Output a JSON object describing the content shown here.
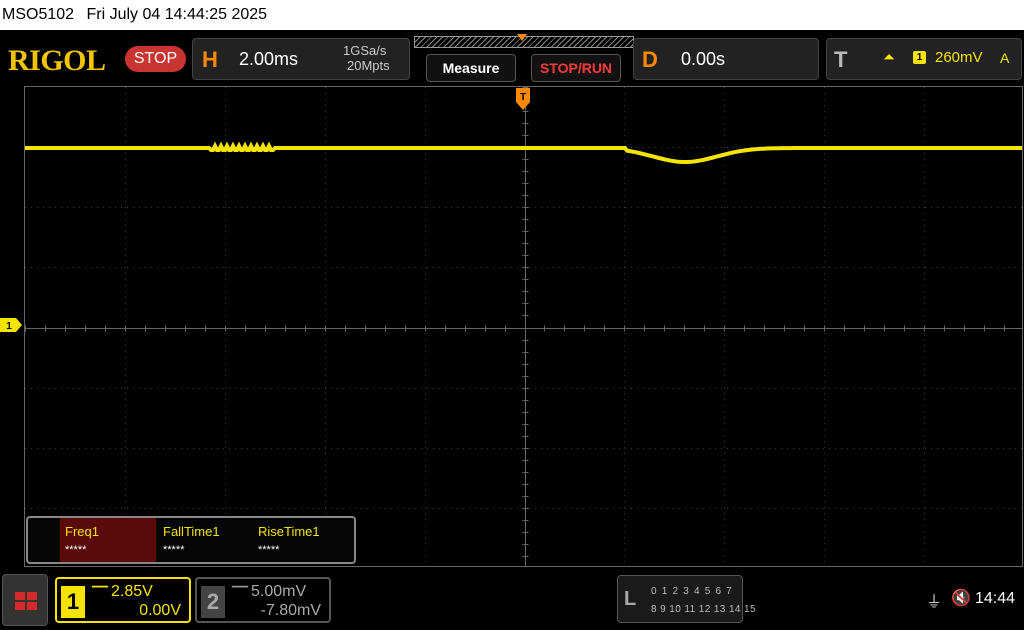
{
  "status_bar": {
    "model": "MSO5102",
    "datetime": "Fri July 04 14:44:25 2025"
  },
  "header": {
    "brand": "RIGOL",
    "run_state": "STOP",
    "horizontal": {
      "letter": "H",
      "timebase": "2.00ms",
      "sample_rate": "1GSa/s",
      "memory_depth": "20Mpts"
    },
    "measure_label": "Measure",
    "stop_run_label": "STOP/RUN",
    "delay": {
      "letter": "D",
      "value": "0.00s"
    },
    "trigger": {
      "letter": "T",
      "edge_icon": "rising-edge-icon",
      "source": "1",
      "level": "260mV",
      "mode": "A"
    }
  },
  "screen": {
    "trigger_marker": "T",
    "ch1_marker": "1",
    "trace_color": "#f4e400",
    "grid_divisions": {
      "horizontal": 10,
      "vertical": 8
    }
  },
  "measurements": [
    {
      "name": "Freq1",
      "value": "*****",
      "selected": true
    },
    {
      "name": "FallTime1",
      "value": "*****",
      "selected": false
    },
    {
      "name": "RiseTime1",
      "value": "*****",
      "selected": false
    }
  ],
  "channels": {
    "ch1": {
      "number": "1",
      "coupling_icon": "dc-coupling-icon",
      "scale": "2.85V",
      "offset": "0.00V",
      "color": "#f4e400"
    },
    "ch2": {
      "number": "2",
      "coupling_icon": "dc-coupling-icon",
      "scale": "5.00mV",
      "offset": "-7.80mV",
      "color": "#aaaaaa"
    }
  },
  "logic_analyzer": {
    "letter": "L",
    "row1": "0 1 2 3  4 5 6 7",
    "row2": "8 9 10 11 12 13 14 15"
  },
  "system": {
    "usb_icon": "usb-icon",
    "mute_icon": "speaker-muted-icon",
    "time": "14:44"
  }
}
